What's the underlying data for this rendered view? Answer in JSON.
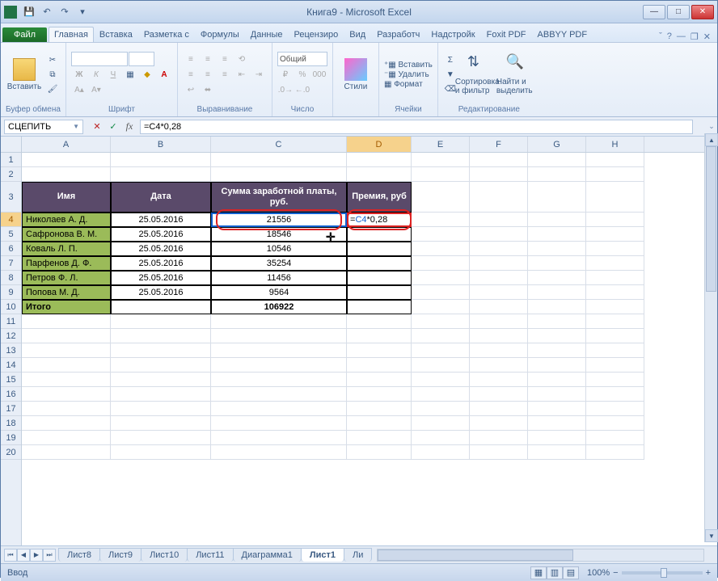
{
  "window": {
    "title": "Книга9 - Microsoft Excel"
  },
  "tabs": {
    "file": "Файл",
    "items": [
      "Главная",
      "Вставка",
      "Разметка с",
      "Формулы",
      "Данные",
      "Рецензиро",
      "Вид",
      "Разработч",
      "Надстройк",
      "Foxit PDF",
      "ABBYY PDF"
    ],
    "active": 0
  },
  "ribbon": {
    "clipboard": {
      "paste": "Вставить",
      "label": "Буфер обмена"
    },
    "font": {
      "name": "",
      "size": "",
      "label": "Шрифт"
    },
    "alignment": {
      "label": "Выравнивание"
    },
    "number": {
      "format": "Общий",
      "label": "Число"
    },
    "styles": {
      "btn": "Стили"
    },
    "cells": {
      "insert": "Вставить",
      "delete": "Удалить",
      "format": "Формат",
      "label": "Ячейки"
    },
    "editing": {
      "sort": "Сортировка и фильтр",
      "find": "Найти и выделить",
      "label": "Редактирование"
    }
  },
  "namebox": "СЦЕПИТЬ",
  "formula_bar": "=C4*0,28",
  "columns": [
    "A",
    "B",
    "C",
    "D",
    "E",
    "F",
    "G",
    "H"
  ],
  "row_count": 20,
  "active_row": 4,
  "active_col": "D",
  "table": {
    "headers": {
      "name": "Имя",
      "date": "Дата",
      "salary": "Сумма заработной платы, руб.",
      "bonus": "Премия, руб"
    },
    "rows": [
      {
        "name": "Николаев А. Д.",
        "date": "25.05.2016",
        "salary": "21556"
      },
      {
        "name": "Сафронова В. М.",
        "date": "25.05.2016",
        "salary": "18546"
      },
      {
        "name": "Коваль Л. П.",
        "date": "25.05.2016",
        "salary": "10546"
      },
      {
        "name": "Парфенов Д. Ф.",
        "date": "25.05.2016",
        "salary": "35254"
      },
      {
        "name": "Петров Ф. Л.",
        "date": "25.05.2016",
        "salary": "11456"
      },
      {
        "name": "Попова М. Д.",
        "date": "25.05.2016",
        "salary": "9564"
      }
    ],
    "total": {
      "label": "Итого",
      "salary": "106922"
    }
  },
  "editing_cell": {
    "prefix": "=",
    "ref": "C4",
    "suffix": "*0,28"
  },
  "sheets": {
    "list": [
      "Лист8",
      "Лист9",
      "Лист10",
      "Лист11",
      "Диаграмма1",
      "Лист1",
      "Ли"
    ],
    "active": 5
  },
  "status": {
    "mode": "Ввод",
    "zoom": "100%"
  }
}
